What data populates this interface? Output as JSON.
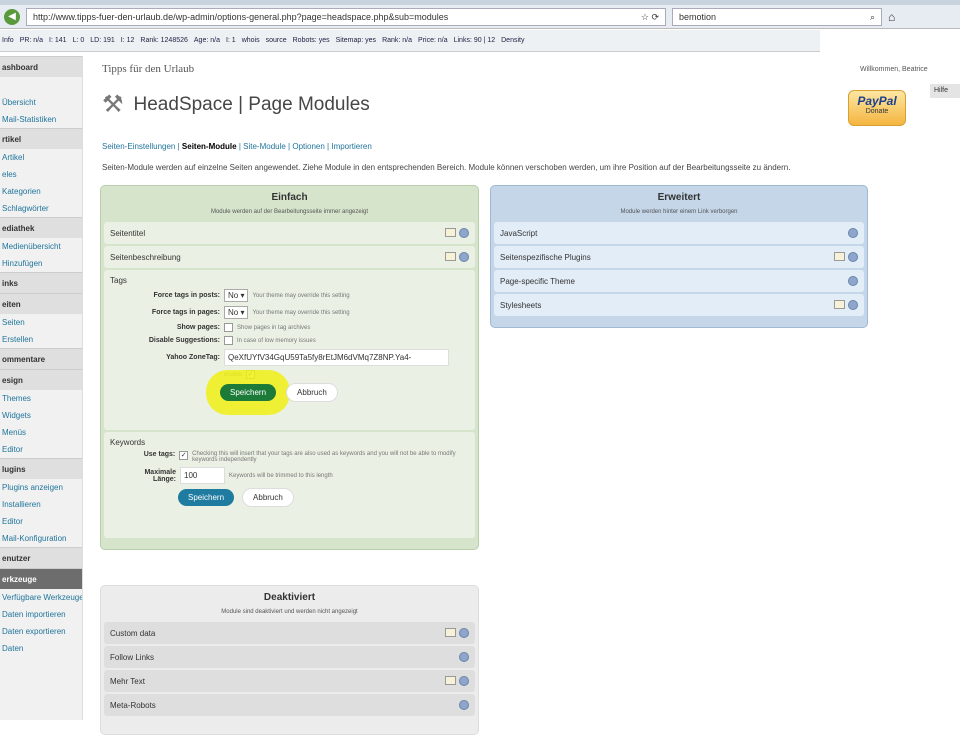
{
  "browser": {
    "url": "http://www.tipps-fuer-den-urlaub.de/wp-admin/options-general.php?page=headspace.php&sub=modules",
    "search": "bemotion"
  },
  "seo_toolbar": [
    "Info",
    "PR: n/a",
    "I: 141",
    "L: 0",
    "LD: 191",
    "I: 12",
    "Rank: 1248526",
    "Age: n/a",
    "I: 1",
    "whois",
    "source",
    "Robots: yes",
    "Sitemap: yes",
    "Rank: n/a",
    "Price: n/a",
    "Links: 90 | 12",
    "Density"
  ],
  "sidebar": [
    {
      "t": "ashboard",
      "h": true
    },
    {
      "t": ""
    },
    {
      "t": "Übersicht"
    },
    {
      "t": "Mail-Statistiken"
    },
    {
      "t": "rtikel",
      "h": true
    },
    {
      "t": "Artikel"
    },
    {
      "t": "eles"
    },
    {
      "t": "Kategorien"
    },
    {
      "t": "Schlagwörter"
    },
    {
      "t": "ediathek",
      "h": true
    },
    {
      "t": "Medienübersicht"
    },
    {
      "t": "Hinzufügen"
    },
    {
      "t": "inks",
      "h": true
    },
    {
      "t": "eiten",
      "h": true
    },
    {
      "t": "Seiten"
    },
    {
      "t": "Erstellen"
    },
    {
      "t": "ommentare",
      "h": true
    },
    {
      "t": "esign",
      "h": true
    },
    {
      "t": "Themes"
    },
    {
      "t": "Widgets"
    },
    {
      "t": "Menüs"
    },
    {
      "t": "Editor"
    },
    {
      "t": "lugins",
      "h": true
    },
    {
      "t": "Plugins anzeigen"
    },
    {
      "t": "Installieren"
    },
    {
      "t": "Editor"
    },
    {
      "t": "Mail-Konfiguration"
    },
    {
      "t": "enutzer",
      "h": true
    },
    {
      "t": "erkzeuge",
      "h": true,
      "active": true
    },
    {
      "t": "Verfügbare Werkzeuge"
    },
    {
      "t": "Daten importieren"
    },
    {
      "t": "Daten exportieren"
    },
    {
      "t": "Daten"
    }
  ],
  "header": {
    "site": "Tipps für den Urlaub",
    "welcome": "Willkommen, Beatrice",
    "help": "Hilfe",
    "title": "HeadSpace | Page Modules",
    "paypal": "PayPal",
    "donate": "Donate"
  },
  "subnav": [
    "Seiten-Einstellungen",
    "Seiten-Module",
    "Site-Module",
    "Optionen",
    "Importieren"
  ],
  "description": "Seiten-Module werden auf einzelne Seiten angewendet. Ziehe Module in den entsprechenden Bereich. Module können verschoben werden, um ihre Position auf der Bearbeitungsseite zu ändern.",
  "simple": {
    "title": "Einfach",
    "sub": "Module werden auf der Bearbeitungsseite immer angezeigt",
    "items": [
      "Seitentitel",
      "Seitenbeschreibung"
    ]
  },
  "tags": {
    "title": "Tags",
    "force_posts": "Force tags in posts:",
    "force_pages": "Force tags in pages:",
    "no": "No",
    "override_hint": "Your theme may override this setting",
    "show_pages": "Show pages:",
    "show_pages_hint": "Show pages in tag archives",
    "disable_sugg": "Disable Suggestions:",
    "disable_hint": "In case of low memory issues",
    "zonetag": "Yahoo ZoneTag:",
    "zonetag_value": "QeXfUYfV34GqU59Ta5fy8rEtJM6dVMq7Z8NP.Ya4-",
    "enable": "enable",
    "save": "Speichern",
    "cancel": "Abbruch"
  },
  "keywords": {
    "title": "Keywords",
    "use_tags": "Use tags:",
    "use_tags_hint": "Checking this will insert that your tags are also used as keywords and you will not be able to modify keywords independently",
    "max_label1": "Maximale",
    "max_label2": "Länge:",
    "max_value": "100",
    "max_hint": "Keywords will be trimmed to this length",
    "save": "Speichern",
    "cancel": "Abbruch"
  },
  "advanced": {
    "title": "Erweitert",
    "sub": "Module werden hinter einem Link verborgen",
    "items": [
      {
        "t": "JavaScript",
        "note": false
      },
      {
        "t": "Seitenspezifische Plugins",
        "note": true
      },
      {
        "t": "Page-specific Theme",
        "note": false
      },
      {
        "t": "Stylesheets",
        "note": true
      }
    ]
  },
  "disabled": {
    "title": "Deaktiviert",
    "sub": "Module sind deaktiviert und werden nicht angezeigt",
    "items": [
      {
        "t": "Custom data",
        "note": true
      },
      {
        "t": "Follow Links",
        "note": false
      },
      {
        "t": "Mehr Text",
        "note": true
      },
      {
        "t": "Meta-Robots",
        "note": false
      }
    ]
  }
}
